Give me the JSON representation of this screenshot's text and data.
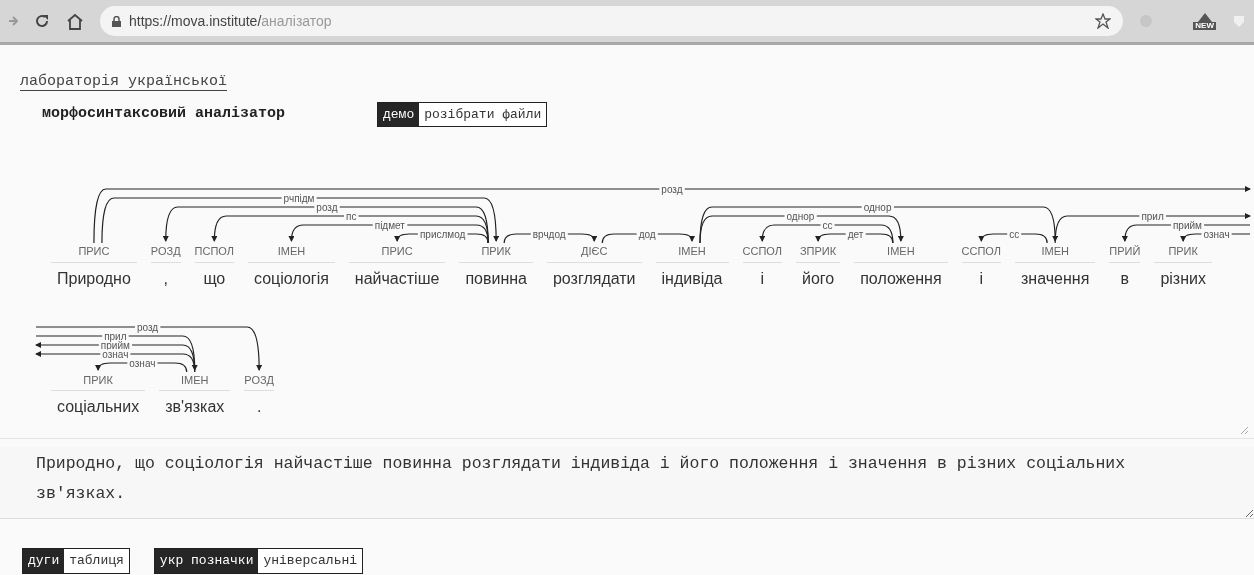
{
  "browser": {
    "url_host": "https://mova.institute/",
    "url_path": "аналізатор",
    "extension_badge": "NEW"
  },
  "header": {
    "lab_link": "лабораторія української",
    "title": "морфосинтаксовий аналізатор"
  },
  "mode_toggle": [
    {
      "label": "демо",
      "selected": true
    },
    {
      "label": "розібрати файли",
      "selected": false
    }
  ],
  "parse": {
    "tree": {
      "word": "Природно",
      "tag": "ПРИС",
      "children": [
        {
          "word": "повинна",
          "tag": "ПРИК",
          "relation": "рчпідм",
          "before_head": false,
          "children": [
            {
              "word": ",",
              "tag": "РОЗД",
              "relation": "розд",
              "before_head": true
            },
            {
              "word": "що",
              "tag": "ПСПОЛ",
              "relation": "пс",
              "before_head": true
            },
            {
              "word": "соціологія",
              "tag": "ІМЕН",
              "relation": "підмет",
              "before_head": true
            },
            {
              "word": "найчастіше",
              "tag": "ПРИС",
              "relation": "прислмод",
              "before_head": true
            },
            {
              "word": "розглядати",
              "tag": "ДІЄС",
              "relation": "врчдод",
              "before_head": false,
              "children": [
                {
                  "word": "індивіда",
                  "tag": "ІМЕН",
                  "relation": "дод",
                  "before_head": false,
                  "children": [
                    {
                      "word": "положення",
                      "tag": "ІМЕН",
                      "relation": "однор",
                      "before_head": false,
                      "children": [
                        {
                          "word": "і",
                          "tag": "ССПОЛ",
                          "relation": "сс",
                          "before_head": true
                        },
                        {
                          "word": "його",
                          "tag": "ЗПРИК",
                          "relation": "дет",
                          "before_head": true
                        }
                      ]
                    },
                    {
                      "word": "значення",
                      "tag": "ІМЕН",
                      "relation": "однор",
                      "before_head": false,
                      "children": [
                        {
                          "word": "і",
                          "tag": "ССПОЛ",
                          "relation": "сс",
                          "before_head": true
                        },
                        {
                          "word": "зв'язках",
                          "tag": "ІМЕН",
                          "relation": "прил",
                          "relation_other_line": "прил",
                          "before_head": false,
                          "children": [
                            {
                              "word": "в",
                              "tag": "ПРИЙ",
                              "relation": "прийм",
                              "relation_other_line": "прийм",
                              "before_head": true
                            },
                            {
                              "word": "різних",
                              "tag": "ПРИК",
                              "relation": "означ",
                              "relation_other_line": "означ",
                              "before_head": true
                            },
                            {
                              "word": "соціальних",
                              "tag": "ПРИК",
                              "relation": "означ",
                              "before_head": true,
                              "new_line": true
                            }
                          ]
                        }
                      ]
                    }
                  ]
                }
              ]
            }
          ]
        },
        {
          "word": ".",
          "tag": "РОЗД",
          "relation": "розд",
          "relation_other_line": "розд",
          "before_head": false
        }
      ]
    }
  },
  "sentence_input": {
    "value": "Природно, що соціологія найчастіше повинна розглядати індивіда і його положення і значення в різних соціальних зв'язках."
  },
  "view_toggle": [
    {
      "label": "дуги",
      "selected": true
    },
    {
      "label": "таблиця",
      "selected": false
    }
  ],
  "tagset_toggle": [
    {
      "label": "укр позначки",
      "selected": true
    },
    {
      "label": "універсальні",
      "selected": false
    }
  ]
}
